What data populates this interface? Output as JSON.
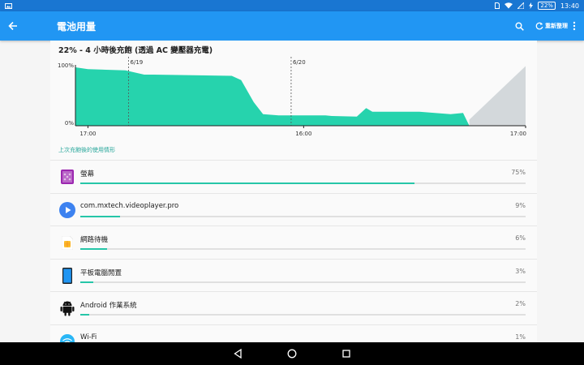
{
  "status_bar": {
    "time": "13:40",
    "battery": "22%"
  },
  "app_bar": {
    "title": "電池用量",
    "refresh_label": "重新整理"
  },
  "headline": "22% - 4 小時後充飽 (透過 AC 變壓器充電)",
  "chart_data": {
    "type": "area",
    "y_ticks": [
      "100%",
      "0%"
    ],
    "x_ticks": [
      "17:00",
      "16:00",
      "17:00"
    ],
    "markers": [
      "6/19",
      "6/20"
    ],
    "series": [
      {
        "values": [
          [
            0,
            96
          ],
          [
            0.04,
            93
          ],
          [
            0.16,
            91
          ],
          [
            0.22,
            84
          ],
          [
            0.25,
            84
          ],
          [
            0.5,
            82
          ],
          [
            0.53,
            75
          ],
          [
            0.57,
            39
          ],
          [
            0.6,
            19
          ],
          [
            0.65,
            17
          ],
          [
            0.8,
            17
          ],
          [
            0.82,
            16
          ],
          [
            0.9,
            15
          ],
          [
            0.93,
            29
          ],
          [
            0.95,
            23
          ],
          [
            1.1,
            23
          ],
          [
            1.15,
            21
          ],
          [
            1.2,
            19
          ],
          [
            1.24,
            21
          ],
          [
            1.26,
            0
          ]
        ]
      }
    ],
    "projection": [
      [
        1.26,
        0
      ],
      [
        1.26,
        10
      ],
      [
        1.44,
        98
      ],
      [
        1.44,
        0
      ]
    ],
    "x_range": [
      0,
      1.44
    ],
    "y_range": [
      0,
      100
    ],
    "fill_color": "#26d3ad",
    "projection_color": "#d3d8db"
  },
  "section_label": "上次充飽後的使用情形",
  "usage": [
    {
      "name": "螢幕",
      "percent": "75%",
      "fraction": 0.75,
      "icon": "screen-icon"
    },
    {
      "name": "com.mxtech.videoplayer.pro",
      "percent": "9%",
      "fraction": 0.09,
      "icon": "play-icon"
    },
    {
      "name": "網路待機",
      "percent": "6%",
      "fraction": 0.06,
      "icon": "sim-icon"
    },
    {
      "name": "平板電腦閒置",
      "percent": "3%",
      "fraction": 0.03,
      "icon": "tablet-icon"
    },
    {
      "name": "Android 作業系統",
      "percent": "2%",
      "fraction": 0.02,
      "icon": "android-icon"
    },
    {
      "name": "Wi-Fi",
      "percent": "1%",
      "fraction": 0.01,
      "icon": "wifi-icon"
    }
  ],
  "colors": {
    "accent": "#26c6a8",
    "primary": "#2196f3",
    "primary_dark": "#1976d2"
  }
}
